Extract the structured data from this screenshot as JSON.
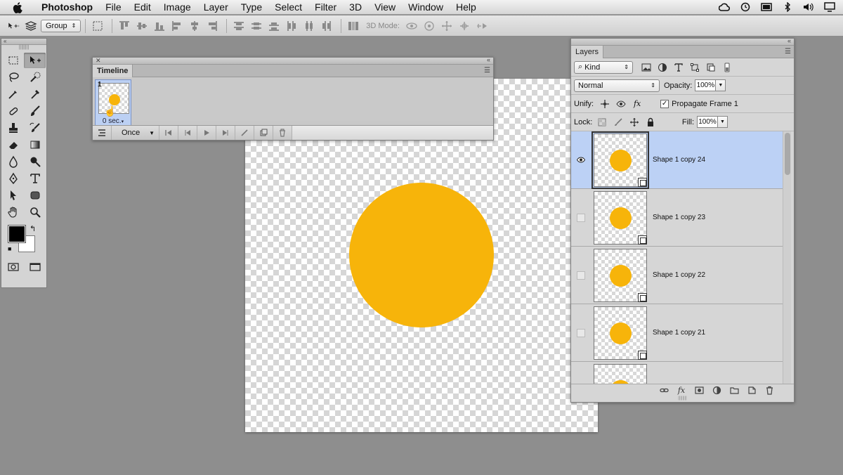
{
  "menubar": {
    "app_name": "Photoshop",
    "items": [
      "File",
      "Edit",
      "Image",
      "Layer",
      "Type",
      "Select",
      "Filter",
      "3D",
      "View",
      "Window",
      "Help"
    ]
  },
  "optionsbar": {
    "auto_select_value": "Group",
    "mode_3d_label": "3D Mode:"
  },
  "timeline": {
    "title": "Timeline",
    "frame": {
      "number": "1",
      "delay": "0 sec."
    },
    "loop_option": "Once"
  },
  "layers": {
    "title": "Layers",
    "filter_kind": "Kind",
    "blend_mode": "Normal",
    "opacity_label": "Opacity:",
    "opacity_value": "100%",
    "unify_label": "Unify:",
    "propagate_label": "Propagate Frame 1",
    "lock_label": "Lock:",
    "fill_label": "Fill:",
    "fill_value": "100%",
    "items": [
      {
        "name": "Shape 1 copy 24",
        "visible": true,
        "selected": true
      },
      {
        "name": "Shape 1 copy 23",
        "visible": false,
        "selected": false
      },
      {
        "name": "Shape 1 copy 22",
        "visible": false,
        "selected": false
      },
      {
        "name": "Shape 1 copy 21",
        "visible": false,
        "selected": false
      },
      {
        "name": "",
        "visible": false,
        "selected": false
      }
    ]
  },
  "colors": {
    "shape_fill": "#f7b40a",
    "selection": "#bcd1f5",
    "workspace": "#8e8e8e"
  }
}
